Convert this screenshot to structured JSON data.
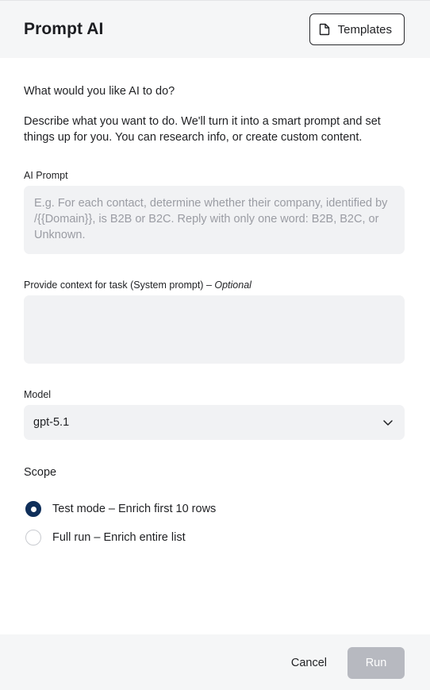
{
  "header": {
    "title": "Prompt AI",
    "templates_label": "Templates",
    "templates_icon": "document-icon"
  },
  "intro": {
    "question": "What would you like AI to do?",
    "description": "Describe what you want to do. We'll turn it into a smart prompt and set things up for you. You can research info, or create custom content."
  },
  "prompt": {
    "label": "AI Prompt",
    "value": "",
    "placeholder": "E.g. For each contact, determine whether their company, identified by /{{Domain}}, is B2B or B2C. Reply with only one word: B2B, B2C, or Unknown."
  },
  "context": {
    "label": "Provide context for task (System prompt) –",
    "optional_label": "Optional",
    "value": "",
    "placeholder": ""
  },
  "model": {
    "label": "Model",
    "selected": "gpt-5.1",
    "icon": "chevron-down-icon"
  },
  "scope": {
    "title": "Scope",
    "options": [
      {
        "label": "Test mode – Enrich first 10 rows",
        "checked": true
      },
      {
        "label": "Full run – Enrich entire list",
        "checked": false
      }
    ]
  },
  "footer": {
    "cancel_label": "Cancel",
    "run_label": "Run",
    "run_disabled": true
  },
  "colors": {
    "header_bg": "#f5f6f7",
    "field_bg": "#f1f2f4",
    "radio_checked": "#0f2f5a",
    "run_disabled_bg": "#b7b9c0"
  }
}
